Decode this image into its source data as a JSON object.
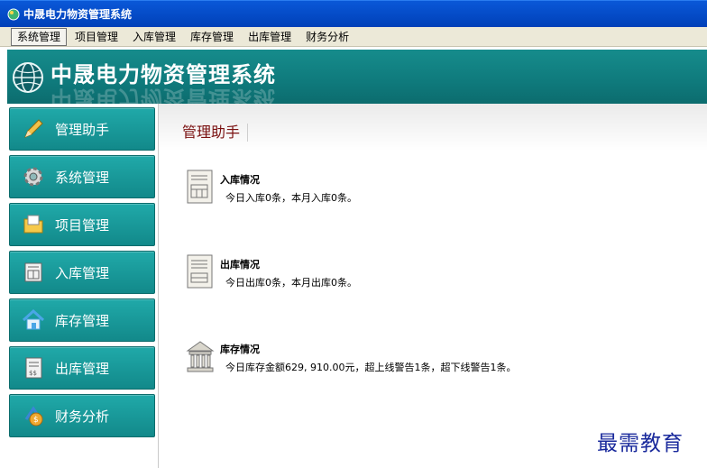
{
  "window": {
    "title": "中晟电力物资管理系统"
  },
  "menu": [
    {
      "label": "系统管理",
      "active": true
    },
    {
      "label": "项目管理",
      "active": false
    },
    {
      "label": "入库管理",
      "active": false
    },
    {
      "label": "库存管理",
      "active": false
    },
    {
      "label": "出库管理",
      "active": false
    },
    {
      "label": "财务分析",
      "active": false
    }
  ],
  "banner": {
    "logo_text": "中晟电力物资管理系统"
  },
  "sidebar": {
    "items": [
      {
        "label": "管理助手",
        "icon": "pencil-icon"
      },
      {
        "label": "系统管理",
        "icon": "gear-icon"
      },
      {
        "label": "项目管理",
        "icon": "folder-icon"
      },
      {
        "label": "入库管理",
        "icon": "stock-in-icon"
      },
      {
        "label": "库存管理",
        "icon": "house-icon"
      },
      {
        "label": "出库管理",
        "icon": "stock-out-icon"
      },
      {
        "label": "财务分析",
        "icon": "money-icon"
      }
    ]
  },
  "main": {
    "title": "管理助手",
    "sections": [
      {
        "title": "入库情况",
        "desc": "今日入库0条，本月入库0条。",
        "icon": "document-icon"
      },
      {
        "title": "出库情况",
        "desc": "今日出库0条，本月出库0条。",
        "icon": "document-icon"
      },
      {
        "title": "库存情况",
        "desc": "今日库存金额629, 910.00元，超上线警告1条，超下线警告1条。",
        "icon": "bank-icon"
      }
    ]
  },
  "watermark": "最需教育",
  "colors": {
    "titlebar": "#0a58d8",
    "teal": "#168c8c",
    "title_red": "#7a1010",
    "watermark": "#1a2a9c"
  }
}
